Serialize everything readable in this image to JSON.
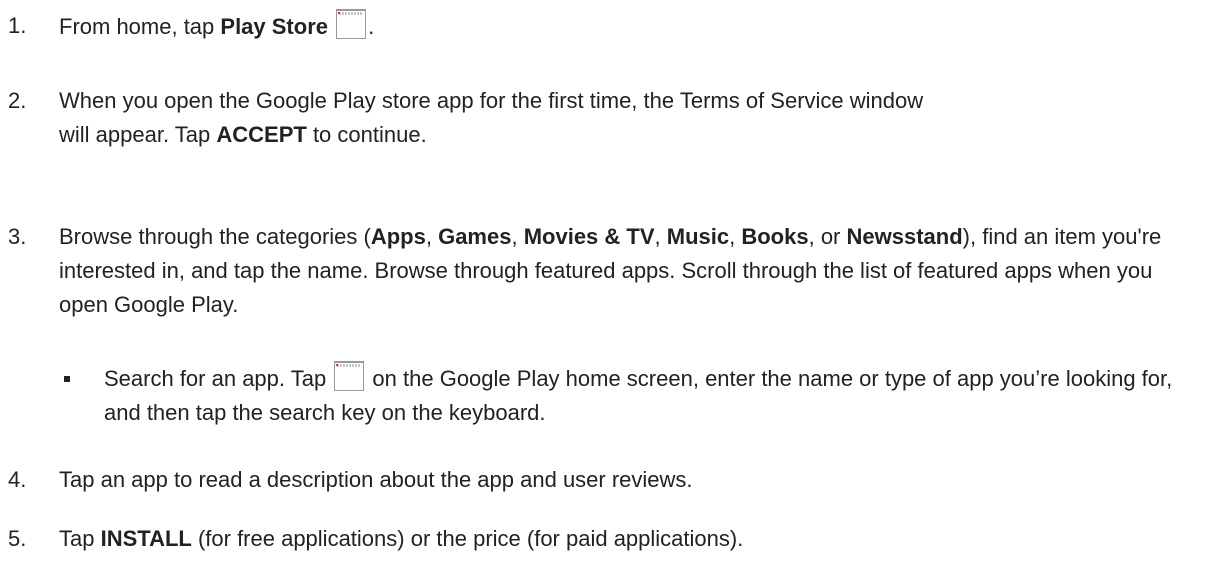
{
  "steps": [
    {
      "number": "1.",
      "pre": "From home, tap ",
      "bold": "Play Store",
      "icon": "play-store-icon",
      "post": "."
    },
    {
      "number": "2.",
      "pre": "When you open the Google Play store app for the first time, the Terms of Service window will appear. Tap ",
      "bold": "ACCEPT",
      "post": " to continue."
    },
    {
      "number": "3.",
      "pre": "Browse through the categories (",
      "cat_apps": "Apps",
      "sep1": ", ",
      "cat_games": "Games",
      "sep2": ", ",
      "cat_movies": "Movies & TV",
      "sep3": ", ",
      "cat_music": "Music",
      "sep4": ", ",
      "cat_books": "Books",
      "sep5": ", or ",
      "cat_newsstand": "Newsstand",
      "post": "), find an item you're interested in, and tap the name. Browse through featured apps. Scroll through the list of featured apps when you open Google Play."
    },
    {
      "number": "4.",
      "text": "Tap an app to read a description about the app and user reviews."
    },
    {
      "number": "5.",
      "pre": "Tap ",
      "bold": "INSTALL",
      "post": " (for free applications) or the price (for paid applications)."
    }
  ],
  "bullet": {
    "pre": "Search for an app. Tap ",
    "icon": "search-icon",
    "post": " on the Google Play home screen, enter the name or type of app you’re looking for, and then tap the search key on the keyboard."
  }
}
